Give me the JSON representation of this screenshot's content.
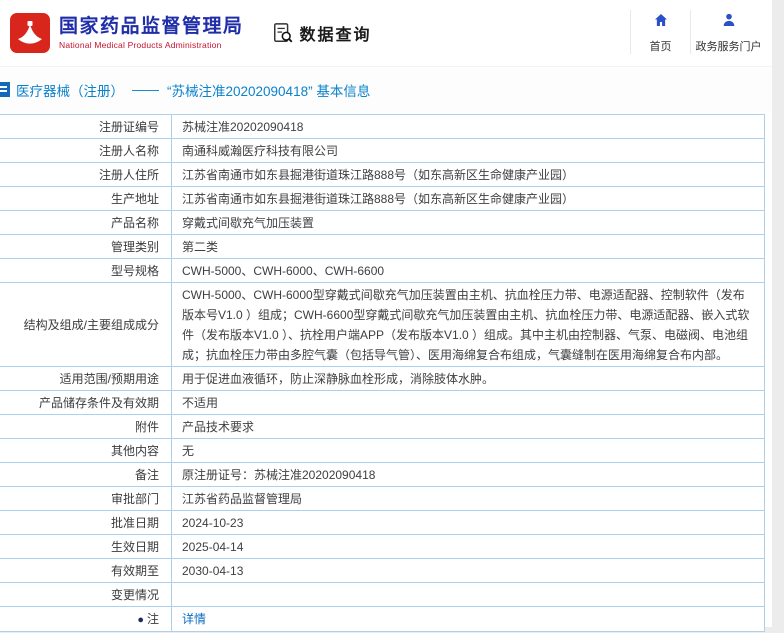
{
  "header": {
    "logo_cn": "国家药品监督管理局",
    "logo_en": "National Medical Products Administration",
    "query_title": "数据查询",
    "nav": [
      {
        "label": "首页"
      },
      {
        "label": "政务服务门户"
      }
    ]
  },
  "breadcrumb": {
    "section": "医疗器械（注册）",
    "separator": "——",
    "title": "“苏械注准20202090418” 基本信息"
  },
  "table": {
    "rows": [
      {
        "label": "注册证编号",
        "value": "苏械注准20202090418"
      },
      {
        "label": "注册人名称",
        "value": "南通科威瀚医疗科技有限公司"
      },
      {
        "label": "注册人住所",
        "value": "江苏省南通市如东县掘港街道珠江路888号（如东高新区生命健康产业园）"
      },
      {
        "label": "生产地址",
        "value": "江苏省南通市如东县掘港街道珠江路888号（如东高新区生命健康产业园）"
      },
      {
        "label": "产品名称",
        "value": "穿戴式间歇充气加压装置"
      },
      {
        "label": "管理类别",
        "value": "第二类"
      },
      {
        "label": "型号规格",
        "value": "CWH-5000、CWH-6000、CWH-6600"
      },
      {
        "label": "结构及组成/主要组成成分",
        "value": "CWH-5000、CWH-6000型穿戴式间歇充气加压装置由主机、抗血栓压力带、电源适配器、控制软件（发布版本号V1.0 ）组成；CWH-6600型穿戴式间歇充气加压装置由主机、抗血栓压力带、电源适配器、嵌入式软件（发布版本V1.0 ）、抗栓用户端APP（发布版本V1.0 ）组成。其中主机由控制器、气泵、电磁阀、电池组成；抗血栓压力带由多腔气囊（包括导气管）、医用海绵复合布组成，气囊缝制在医用海绵复合布内部。"
      },
      {
        "label": "适用范围/预期用途",
        "value": "用于促进血液循环，防止深静脉血栓形成，消除肢体水肿。"
      },
      {
        "label": "产品储存条件及有效期",
        "value": "不适用"
      },
      {
        "label": "附件",
        "value": "产品技术要求"
      },
      {
        "label": "其他内容",
        "value": "无"
      },
      {
        "label": "备注",
        "value": "原注册证号：苏械注准20202090418"
      },
      {
        "label": "审批部门",
        "value": "江苏省药品监督管理局"
      },
      {
        "label": "批准日期",
        "value": "2024-10-23"
      },
      {
        "label": "生效日期",
        "value": "2025-04-14"
      },
      {
        "label": "有效期至",
        "value": "2030-04-13"
      },
      {
        "label": "变更情况",
        "value": ""
      },
      {
        "label": "注",
        "label_icon": "●",
        "value": "详情",
        "link": true
      }
    ]
  },
  "colors": {
    "logo_blue": "#1f2da8",
    "logo_red": "#d9261c",
    "title_blue": "#0b82cc",
    "border_blue": "#aed0ec",
    "link_blue": "#0a6cc4",
    "icon_blue": "#2b50c8"
  }
}
